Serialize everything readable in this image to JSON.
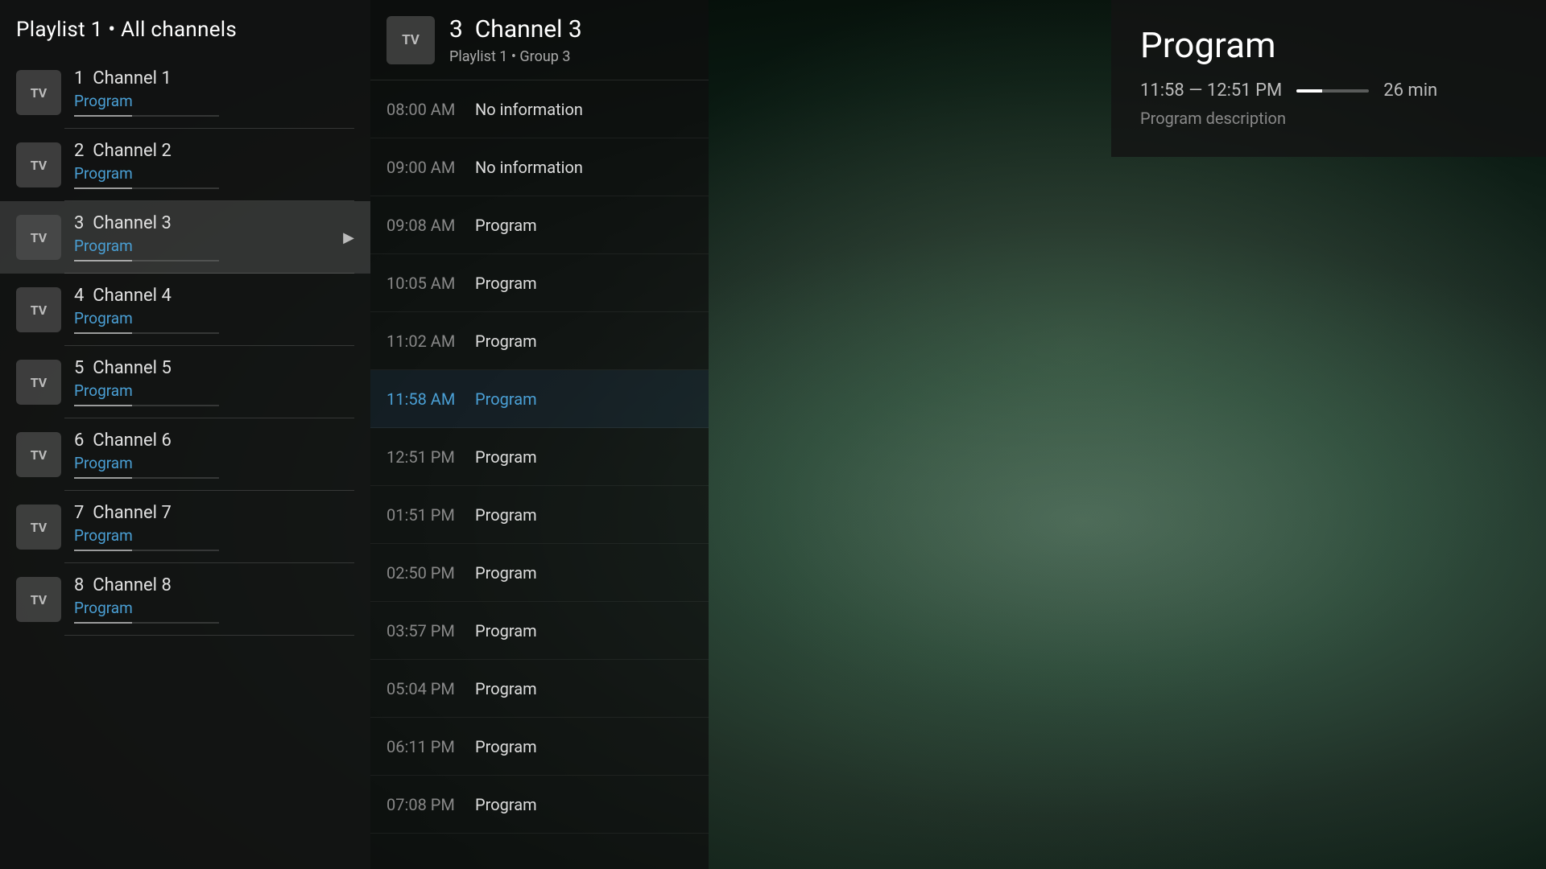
{
  "sidebar": {
    "header": "Playlist 1  •  All channels",
    "channels": [
      {
        "id": 1,
        "number": "1",
        "name": "Channel 1",
        "program": "Program",
        "active": false
      },
      {
        "id": 2,
        "number": "2",
        "name": "Channel 2",
        "program": "Program",
        "active": false
      },
      {
        "id": 3,
        "number": "3",
        "name": "Channel 3",
        "program": "Program",
        "active": true
      },
      {
        "id": 4,
        "number": "4",
        "name": "Channel 4",
        "program": "Program",
        "active": false
      },
      {
        "id": 5,
        "number": "5",
        "name": "Channel 5",
        "program": "Program",
        "active": false
      },
      {
        "id": 6,
        "number": "6",
        "name": "Channel 6",
        "program": "Program",
        "active": false
      },
      {
        "id": 7,
        "number": "7",
        "name": "Channel 7",
        "program": "Program",
        "active": false
      },
      {
        "id": 8,
        "number": "8",
        "name": "Channel 8",
        "program": "Program",
        "active": false
      }
    ],
    "logo_text": "TV"
  },
  "epg": {
    "channel_logo": "TV",
    "channel_number": "3",
    "channel_name": "Channel 3",
    "channel_meta": "Playlist 1  •  Group 3",
    "items": [
      {
        "time": "08:00 AM",
        "title": "No information",
        "current": false
      },
      {
        "time": "09:00 AM",
        "title": "No information",
        "current": false
      },
      {
        "time": "09:08 AM",
        "title": "Program",
        "current": false
      },
      {
        "time": "10:05 AM",
        "title": "Program",
        "current": false
      },
      {
        "time": "11:02 AM",
        "title": "Program",
        "current": false
      },
      {
        "time": "11:58 AM",
        "title": "Program",
        "current": true
      },
      {
        "time": "12:51 PM",
        "title": "Program",
        "current": false
      },
      {
        "time": "01:51 PM",
        "title": "Program",
        "current": false
      },
      {
        "time": "02:50 PM",
        "title": "Program",
        "current": false
      },
      {
        "time": "03:57 PM",
        "title": "Program",
        "current": false
      },
      {
        "time": "05:04 PM",
        "title": "Program",
        "current": false
      },
      {
        "time": "06:11 PM",
        "title": "Program",
        "current": false
      },
      {
        "time": "07:08 PM",
        "title": "Program",
        "current": false
      }
    ]
  },
  "program_info": {
    "title": "Program",
    "time_range": "11:58 — 12:51 PM",
    "duration": "26 min",
    "description": "Program description",
    "progress_pct": 35
  }
}
